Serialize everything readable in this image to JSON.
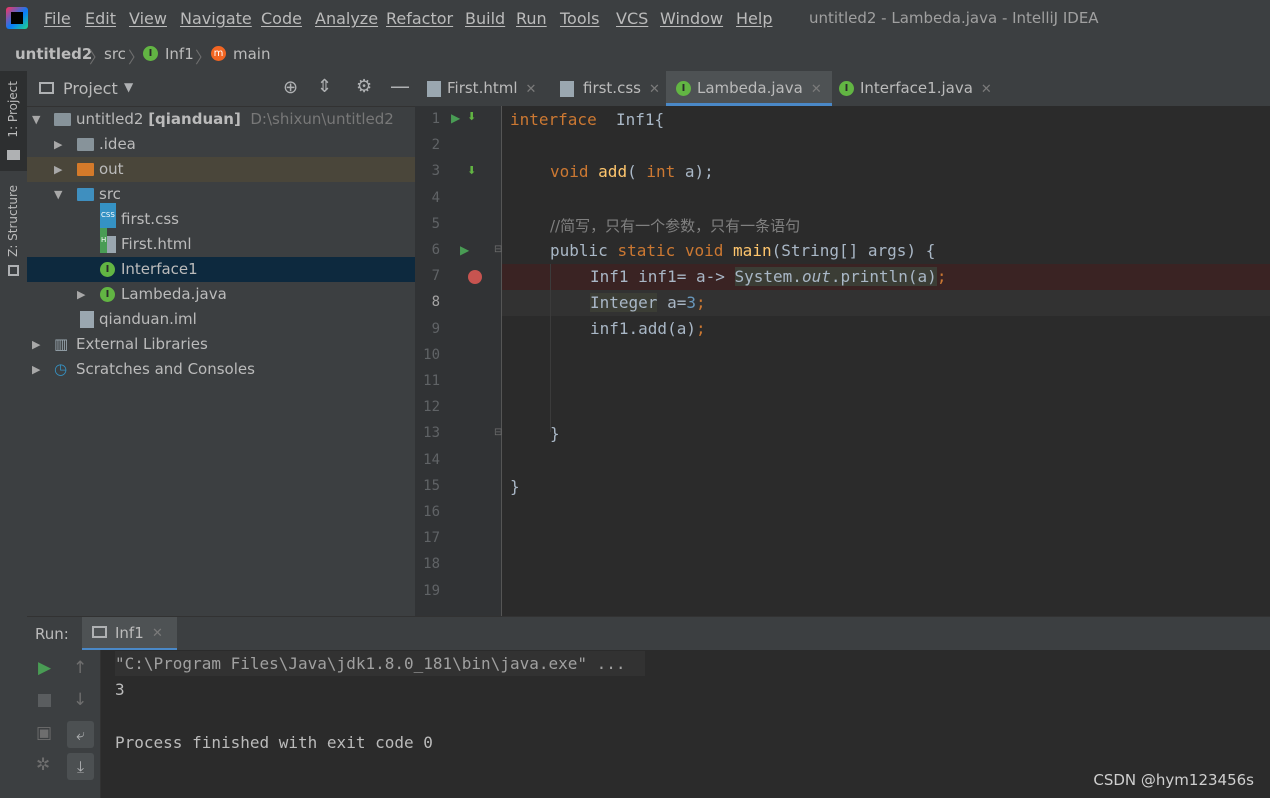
{
  "menu": [
    "File",
    "Edit",
    "View",
    "Navigate",
    "Code",
    "Analyze",
    "Refactor",
    "Build",
    "Run",
    "Tools",
    "VCS",
    "Window",
    "Help"
  ],
  "window_title": "untitled2 - Lambeda.java - IntelliJ IDEA",
  "breadcrumb": {
    "project": "untitled2",
    "folder": "src",
    "class": "Inf1",
    "method": "main"
  },
  "side_tabs": {
    "project": "1: Project",
    "structure": "Z: Structure"
  },
  "project_panel": {
    "title": "Project",
    "tree": [
      {
        "label": "untitled2",
        "bold_suffix": "[qianduan]",
        "path": "D:\\shixun\\untitled2"
      },
      {
        "label": ".idea"
      },
      {
        "label": "out"
      },
      {
        "label": "src"
      },
      {
        "label": "first.css"
      },
      {
        "label": "First.html"
      },
      {
        "label": "Interface1"
      },
      {
        "label": "Lambeda.java"
      },
      {
        "label": "qianduan.iml"
      },
      {
        "label": "External Libraries"
      },
      {
        "label": "Scratches and Consoles"
      }
    ]
  },
  "tabs": [
    {
      "label": "First.html"
    },
    {
      "label": "first.css"
    },
    {
      "label": "Lambeda.java",
      "active": true
    },
    {
      "label": "Interface1.java"
    }
  ],
  "line_numbers": [
    "1",
    "2",
    "3",
    "4",
    "5",
    "6",
    "7",
    "8",
    "9",
    "10",
    "11",
    "12",
    "13",
    "14",
    "15",
    "16",
    "17",
    "18",
    "19"
  ],
  "code": {
    "l1_kw": "interface",
    "l1_rest": "  Inf1{",
    "l3_kw": "void",
    "l3_fn": "add",
    "l3_a": "( ",
    "l3_kw2": "int",
    "l3_b": " a);",
    "l5": "//简写，只有一个参数，只有一条语句",
    "l6_a": "public ",
    "l6_kw": "static void",
    "l6_fn": "main",
    "l6_b": "(String[] args) {",
    "l7_a": "Inf1 inf1= a-> ",
    "l7_hl1": "System.",
    "l7_st": "out",
    "l7_hl2": ".println(a)",
    "l7_semi": ";",
    "l8_hl": "Integer",
    "l8_a": " a=",
    "l8_num": "3",
    "l8_semi": ";",
    "l9_a": "inf1.add(a)",
    "l9_semi": ";",
    "l13": "}",
    "l15": "}"
  },
  "run": {
    "label": "Run:",
    "tab": "Inf1",
    "console": [
      "\"C:\\Program Files\\Java\\jdk1.8.0_181\\bin\\java.exe\" ...",
      "3",
      "",
      "Process finished with exit code 0"
    ]
  },
  "watermark": "CSDN @hym123456s",
  "colors": {
    "accent": "#4a88c7",
    "keyword": "#cc7832",
    "function": "#ffc66d",
    "selected_row": "#0d293e",
    "breakpoint": "#c75450"
  }
}
